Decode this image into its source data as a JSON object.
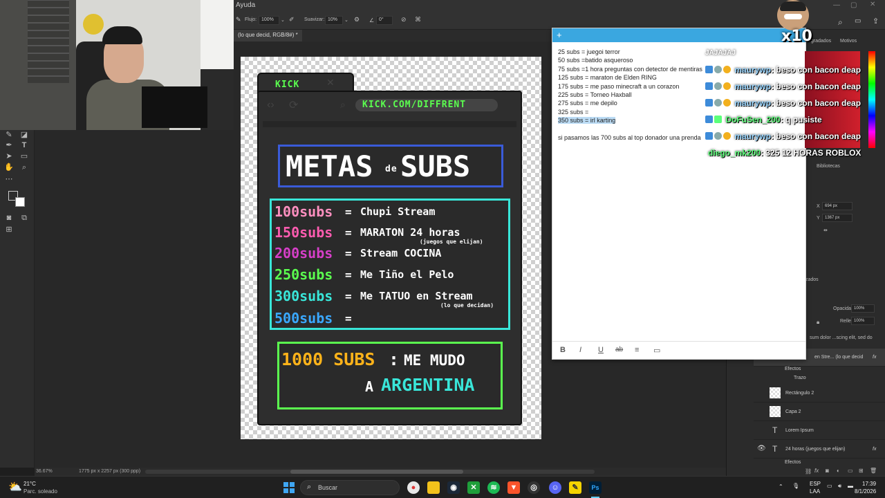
{
  "photoshop": {
    "menu_label": "Ayuda",
    "options": {
      "flow_label": "Flujo:",
      "flow_value": "100%",
      "smoothing_label": "Suavizar:",
      "smoothing_value": "10%",
      "angle_value": "0°"
    },
    "document_tab": "(lo que decid, RGB/8#) *",
    "status": {
      "zoom": "36.67%",
      "dimensions": "1775 px x 2257 px (300 ppp)"
    },
    "right_panel": {
      "tab_gradients": "egradados",
      "tab_patterns": "Motivos",
      "libraries": "Bibliotecas",
      "x_label": "X",
      "x_value": "694 px",
      "y_label": "Y",
      "y_value": "1367 px",
      "adjusted": "zados",
      "opacity_label": "Opacidad:",
      "opacity_value": "100%",
      "fill_label": "Relleno:",
      "fill_value": "100%",
      "lorem_partial": "sum dolor ...scing elit, sed do"
    },
    "layers": [
      {
        "label": "en Stre...   (lo que decid",
        "fx": "fx"
      },
      {
        "label": "Efectos",
        "fx": ""
      },
      {
        "label": "Trazo",
        "fx": ""
      },
      {
        "label": "Rectángulo 2",
        "fx": ""
      },
      {
        "label": "Capa 2",
        "fx": ""
      },
      {
        "label": "Lorem Ipsum",
        "fx": ""
      },
      {
        "label": "24 horas (juegos que elijan)",
        "fx": "fx"
      },
      {
        "label": "Efectos",
        "fx": ""
      }
    ]
  },
  "design": {
    "tab_label": "KICK",
    "url": "KICK.COM/DIFFRENT",
    "title_big1": "METAS",
    "title_small": "de",
    "title_big2": "SUBS",
    "goals": [
      {
        "subs": "100subs",
        "eq": "=",
        "text": "Chupi Stream",
        "note": "",
        "color": "#ff8fbf"
      },
      {
        "subs": "150subs",
        "eq": "=",
        "text": "MARATON 24 horas",
        "note": "(juegos que elijan)",
        "color": "#ff5cb0"
      },
      {
        "subs": "200subs",
        "eq": "=",
        "text": "Stream COCINA",
        "note": "",
        "color": "#d63fc8"
      },
      {
        "subs": "250subs",
        "eq": "=",
        "text": "Me Tiño el Pelo",
        "note": "",
        "color": "#5bff4f"
      },
      {
        "subs": "300subs",
        "eq": "=",
        "text": "Me TATUO en Stream",
        "note": "(lo que decidan)",
        "color": "#39e6d9"
      },
      {
        "subs": "500subs",
        "eq": "=",
        "text": "",
        "note": "",
        "color": "#3aa8ff"
      }
    ],
    "big_goal_number": "1000 SUBS",
    "big_goal_colon": ":",
    "big_goal_text1": "ME MUDO",
    "big_goal_text2": "A",
    "big_goal_text3": "ARGENTINA"
  },
  "note": {
    "lines": [
      "25 subs = juegoi terror",
      "50 subs =batido asqueroso",
      "75 subs =1 hora preguntas con detector de mentiras",
      "125 subs = maraton de Elden RING",
      "175 subs = me paso minecraft a un corazon",
      "225 subs = Torneo Haxball",
      "275 subs = me depilo",
      "325 subs ="
    ],
    "highlighted": "350 subs = irl karting",
    "extra": "si pasamos las 700 subs al top donador una prenda",
    "toolbar": [
      "B",
      "I",
      "U",
      "ab",
      "≡",
      "▭"
    ]
  },
  "chat": {
    "header_partial": "JAJAJAJ",
    "multiplier": "x10",
    "messages": [
      {
        "user": "maurywp",
        "text": ": beso con bacon deap",
        "user_color": "#9ad6ff"
      },
      {
        "user": "maurywp",
        "text": ": beso con bacon deap",
        "user_color": "#9ad6ff"
      },
      {
        "user": "maurywp",
        "text": ": beso con bacon deap",
        "user_color": "#9ad6ff"
      },
      {
        "user": "DoFuSen_200",
        "text": ": q pusiste",
        "user_color": "#5cff7a"
      },
      {
        "user": "maurywp",
        "text": ": beso con bacon deap",
        "user_color": "#9ad6ff"
      },
      {
        "user": "diego_mk200",
        "text": ": 325 12 HORAS ROBLOX",
        "user_color": "#5cff7a"
      }
    ]
  },
  "taskbar": {
    "weather_temp": "21°C",
    "weather_desc": "Parc. soleado",
    "search_label": "Buscar",
    "lang1": "ESP",
    "lang2": "LAA",
    "time": "17:39",
    "date": "8/1/2026"
  }
}
